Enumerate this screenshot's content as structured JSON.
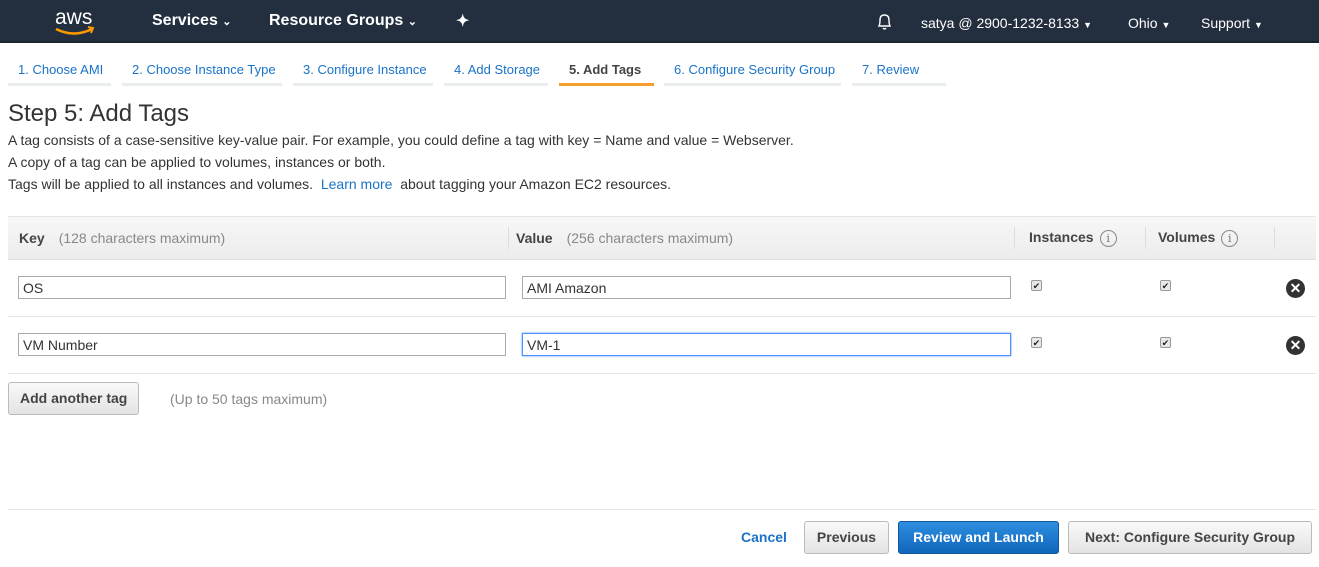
{
  "nav": {
    "logo": "aws",
    "services": "Services",
    "resource_groups": "Resource Groups",
    "account": "satya @ 2900-1232-8133",
    "region": "Ohio",
    "support": "Support"
  },
  "tabs": [
    {
      "label": "1. Choose AMI"
    },
    {
      "label": "2. Choose Instance Type"
    },
    {
      "label": "3. Configure Instance"
    },
    {
      "label": "4. Add Storage"
    },
    {
      "label": "5. Add Tags"
    },
    {
      "label": "6. Configure Security Group"
    },
    {
      "label": "7. Review"
    }
  ],
  "page": {
    "title": "Step 5: Add Tags",
    "line1": "A tag consists of a case-sensitive key-value pair. For example, you could define a tag with key = Name and value = Webserver.",
    "line2": "A copy of a tag can be applied to volumes, instances or both.",
    "line3_pre": "Tags will be applied to all instances and volumes.",
    "learn_more": "Learn more",
    "line3_post": "about tagging your Amazon EC2 resources."
  },
  "table": {
    "key": "Key",
    "key_hint": "(128 characters maximum)",
    "value": "Value",
    "value_hint": "(256 characters maximum)",
    "instances": "Instances",
    "volumes": "Volumes",
    "info": "i",
    "rows": [
      {
        "key": "OS",
        "value": "AMI Amazon",
        "instances": true,
        "volumes": true
      },
      {
        "key": "VM Number",
        "value": "VM-1",
        "instances": true,
        "volumes": true
      }
    ]
  },
  "add_tag": {
    "label": "Add another tag",
    "hint": "(Up to 50 tags maximum)"
  },
  "footer": {
    "cancel": "Cancel",
    "previous": "Previous",
    "review": "Review and Launch",
    "next": "Next: Configure Security Group"
  }
}
